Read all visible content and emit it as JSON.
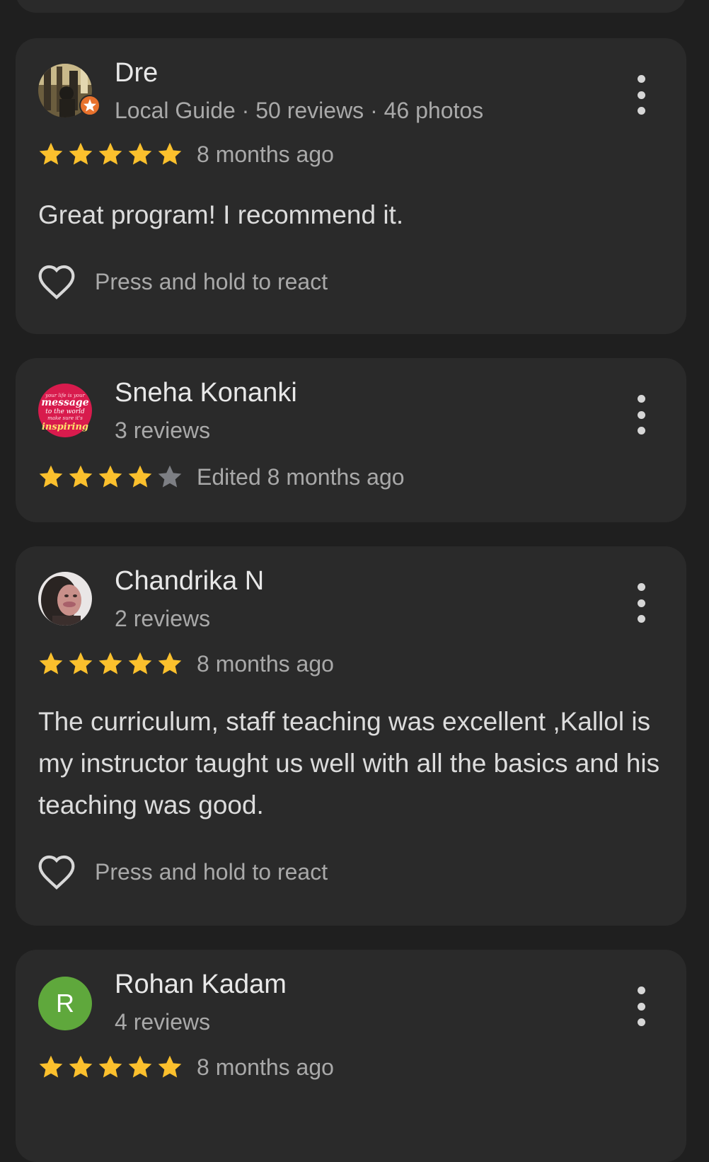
{
  "reviews": [
    {
      "name": "Dre",
      "meta": "Local Guide · 50 reviews · 46 photos",
      "rating": 5,
      "time": "8 months ago",
      "text": "Great program! I recommend it.",
      "react_label": "Press and hold to react",
      "avatar_icon": "photo-avatar-with-local-guide-badge"
    },
    {
      "name": "Sneha Konanki",
      "meta": "3 reviews",
      "rating": 4,
      "time": "Edited 8 months ago",
      "avatar_icon": "pink-quote-avatar",
      "avatar_lines": [
        "your life is your",
        "message",
        "to the world",
        "make sure it's",
        "inspiring"
      ]
    },
    {
      "name": "Chandrika N",
      "meta": "2 reviews",
      "rating": 5,
      "time": "8 months ago",
      "text": "The curriculum, staff teaching was excellent ,Kallol is my instructor taught us well with all the basics and his teaching was good.",
      "react_label": "Press and hold to react",
      "avatar_icon": "portrait-photo-avatar"
    },
    {
      "name": "Rohan Kadam",
      "meta": "4 reviews",
      "rating": 5,
      "time": "8 months ago",
      "avatar_letter": "R",
      "avatar_icon": "letter-avatar"
    }
  ],
  "colors": {
    "background": "#1f1f1f",
    "card": "#2a2a2a",
    "star_filled": "#fbc02d",
    "star_empty": "#7d7f84",
    "avatar_green": "#5fa83c",
    "avatar_pink": "#d81b4d",
    "guide_badge": "#e8712c"
  },
  "icons": {
    "star": "star-icon",
    "more": "more-vert-icon",
    "heart": "heart-outline-icon"
  }
}
